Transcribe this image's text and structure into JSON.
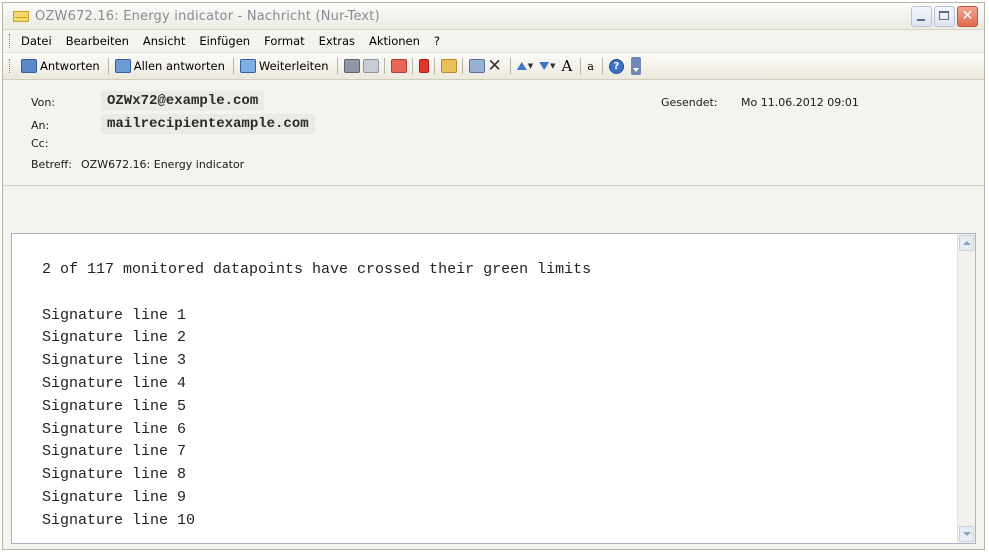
{
  "window": {
    "title": "OZW672.16: Energy indicator - Nachricht (Nur-Text)",
    "icon": "envelope-icon",
    "controls": [
      "minimize",
      "maximize",
      "close"
    ]
  },
  "menu": {
    "items": [
      {
        "label": "Datei"
      },
      {
        "label": "Bearbeiten"
      },
      {
        "label": "Ansicht"
      },
      {
        "label": "Einfügen"
      },
      {
        "label": "Format"
      },
      {
        "label": "Extras"
      },
      {
        "label": "Aktionen"
      },
      {
        "label": "?"
      }
    ]
  },
  "toolbar": {
    "reply_label": "Antworten",
    "reply_all_label": "Allen antworten",
    "forward_label": "Weiterleiten",
    "font_glyph": "A",
    "spell_glyph": "a"
  },
  "header": {
    "from_label": "Von:",
    "from_value": "OZWx72@example.com",
    "to_label": "An:",
    "to_value": "mailrecipientexample.com",
    "cc_label": "Cc:",
    "subject_label": "Betreff:",
    "subject_value": "OZW672.16: Energy indicator",
    "sent_label": "Gesendet:",
    "sent_value": "Mo 11.06.2012 09:01"
  },
  "message": {
    "lines": [
      "2 of 117 monitored datapoints have crossed their green limits",
      "",
      "Signature line 1",
      "Signature line 2",
      "Signature line 3",
      "Signature line 4",
      "Signature line 5",
      "Signature line 6",
      "Signature line 7",
      "Signature line 8",
      "Signature line 9",
      "Signature line 10"
    ]
  }
}
